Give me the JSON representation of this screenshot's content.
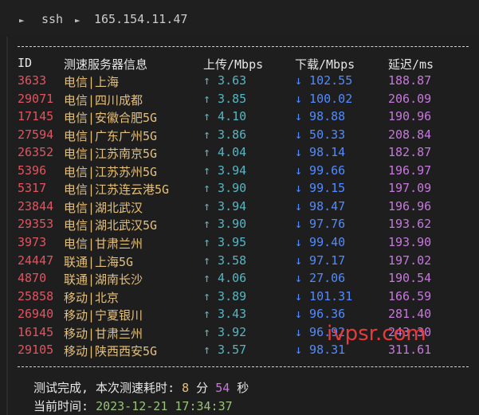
{
  "topbar": {
    "root_label": "",
    "tab1": "ssh",
    "tab2": "165.154.11.47"
  },
  "table": {
    "headers": {
      "id": "ID",
      "server": "测速服务器信息",
      "up": "上传/Mbps",
      "down": "下载/Mbps",
      "lat": "延迟/ms"
    },
    "rows": [
      {
        "id": "3633",
        "server": "电信|上海",
        "up": "↑ 3.63",
        "down": "↓ 102.55",
        "lat": "188.87"
      },
      {
        "id": "29071",
        "server": "电信|四川成都",
        "up": "↑ 3.85",
        "down": "↓ 100.02",
        "lat": "206.09"
      },
      {
        "id": "17145",
        "server": "电信|安徽合肥5G",
        "up": "↑ 4.10",
        "down": "↓ 98.88",
        "lat": "190.96"
      },
      {
        "id": "27594",
        "server": "电信|广东广州5G",
        "up": "↑ 3.86",
        "down": "↓ 50.33",
        "lat": "208.84"
      },
      {
        "id": "26352",
        "server": "电信|江苏南京5G",
        "up": "↑ 4.04",
        "down": "↓ 98.14",
        "lat": "182.87"
      },
      {
        "id": "5396",
        "server": "电信|江苏苏州5G",
        "up": "↑ 3.94",
        "down": "↓ 99.66",
        "lat": "196.97"
      },
      {
        "id": "5317",
        "server": "电信|江苏连云港5G",
        "up": "↑ 3.90",
        "down": "↓ 99.15",
        "lat": "197.09"
      },
      {
        "id": "23844",
        "server": "电信|湖北武汉",
        "up": "↑ 3.94",
        "down": "↓ 98.47",
        "lat": "196.96"
      },
      {
        "id": "29353",
        "server": "电信|湖北武汉5G",
        "up": "↑ 3.90",
        "down": "↓ 97.76",
        "lat": "193.62"
      },
      {
        "id": "3973",
        "server": "电信|甘肃兰州",
        "up": "↑ 3.95",
        "down": "↓ 99.40",
        "lat": "193.90"
      },
      {
        "id": "24447",
        "server": "联通|上海5G",
        "up": "↑ 3.58",
        "down": "↓ 97.17",
        "lat": "197.02"
      },
      {
        "id": "4870",
        "server": "联通|湖南长沙",
        "up": "↑ 4.06",
        "down": "↓ 27.06",
        "lat": "190.54"
      },
      {
        "id": "25858",
        "server": "移动|北京",
        "up": "↑ 3.89",
        "down": "↓ 101.31",
        "lat": "166.59"
      },
      {
        "id": "26940",
        "server": "移动|宁夏银川",
        "up": "↑ 3.43",
        "down": "↓ 96.36",
        "lat": "281.40"
      },
      {
        "id": "16145",
        "server": "移动|甘肃兰州",
        "up": "↑ 3.92",
        "down": "↓ 96.92",
        "lat": "243.30"
      },
      {
        "id": "29105",
        "server": "移动|陕西西安5G",
        "up": "↑ 3.57",
        "down": "↓ 98.31",
        "lat": "311.61"
      }
    ]
  },
  "footer": {
    "done_prefix": "测试完成, 本次测速耗时: ",
    "minutes": "8",
    "min_unit": " 分 ",
    "seconds": "54",
    "sec_unit": " 秒",
    "time_prefix": "当前时间: ",
    "time_value": "2023-12-21 17:34:37"
  },
  "watermark": "ivpsr.com",
  "colors": {
    "background": "#1e1e1e",
    "id": "#e05561",
    "server": "#e5c07b",
    "upload": "#56b6c2",
    "download": "#528bff",
    "latency": "#c678dd"
  }
}
